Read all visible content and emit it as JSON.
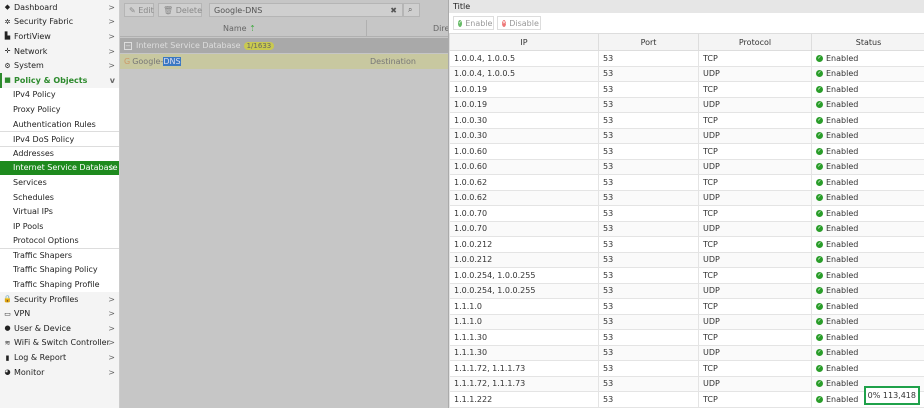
{
  "sidebar": {
    "items": [
      {
        "label": "Dashboard",
        "icon": "dashboard-icon",
        "glyph": "◆",
        "chev": ">"
      },
      {
        "label": "Security Fabric",
        "icon": "security-fabric-icon",
        "glyph": "✲",
        "chev": ">"
      },
      {
        "label": "FortiView",
        "icon": "fortiview-icon",
        "glyph": "▙",
        "chev": ">"
      },
      {
        "label": "Network",
        "icon": "network-icon",
        "glyph": "✛",
        "chev": ">"
      },
      {
        "label": "System",
        "icon": "gear-icon",
        "glyph": "⚙",
        "chev": ">"
      },
      {
        "label": "Policy & Objects",
        "icon": "policy-icon",
        "glyph": "■",
        "chev": "v"
      }
    ],
    "sub": [
      "IPv4 Policy",
      "Proxy Policy",
      "Authentication Rules",
      "IPv4 DoS Policy",
      "Addresses",
      "Internet Service Database",
      "Services",
      "Schedules",
      "Virtual IPs",
      "IP Pools",
      "Protocol Options",
      "Traffic Shapers",
      "Traffic Shaping Policy",
      "Traffic Shaping Profile"
    ],
    "bottom": [
      {
        "label": "Security Profiles",
        "icon": "lock-icon",
        "glyph": "🔒",
        "chev": ">"
      },
      {
        "label": "VPN",
        "icon": "vpn-icon",
        "glyph": "▭",
        "chev": ">"
      },
      {
        "label": "User & Device",
        "icon": "user-icon",
        "glyph": "●",
        "chev": ">"
      },
      {
        "label": "WiFi & Switch Controller",
        "icon": "wifi-icon",
        "glyph": "≋",
        "chev": ">"
      },
      {
        "label": "Log & Report",
        "icon": "log-icon",
        "glyph": "▮",
        "chev": ">"
      },
      {
        "label": "Monitor",
        "icon": "monitor-icon",
        "glyph": "◕",
        "chev": ">"
      }
    ]
  },
  "toolbar": {
    "edit": "Edit",
    "delete": "Delete",
    "search": "Google-DNS"
  },
  "list": {
    "col_name": "Name",
    "col_dir": "Dire",
    "group": "Internet Service Database",
    "badge": "1/1633",
    "entry_prefix": "Google-",
    "entry_highlight": "DNS",
    "direction": "Destination"
  },
  "panel": {
    "title": "Title",
    "enable": "Enable",
    "disable": "Disable",
    "headers": [
      "IP",
      "Port",
      "Protocol",
      "Status"
    ],
    "rows": [
      [
        "1.0.0.4, 1.0.0.5",
        "53",
        "TCP",
        "Enabled"
      ],
      [
        "1.0.0.4, 1.0.0.5",
        "53",
        "UDP",
        "Enabled"
      ],
      [
        "1.0.0.19",
        "53",
        "TCP",
        "Enabled"
      ],
      [
        "1.0.0.19",
        "53",
        "UDP",
        "Enabled"
      ],
      [
        "1.0.0.30",
        "53",
        "TCP",
        "Enabled"
      ],
      [
        "1.0.0.30",
        "53",
        "UDP",
        "Enabled"
      ],
      [
        "1.0.0.60",
        "53",
        "TCP",
        "Enabled"
      ],
      [
        "1.0.0.60",
        "53",
        "UDP",
        "Enabled"
      ],
      [
        "1.0.0.62",
        "53",
        "TCP",
        "Enabled"
      ],
      [
        "1.0.0.62",
        "53",
        "UDP",
        "Enabled"
      ],
      [
        "1.0.0.70",
        "53",
        "TCP",
        "Enabled"
      ],
      [
        "1.0.0.70",
        "53",
        "UDP",
        "Enabled"
      ],
      [
        "1.0.0.212",
        "53",
        "TCP",
        "Enabled"
      ],
      [
        "1.0.0.212",
        "53",
        "UDP",
        "Enabled"
      ],
      [
        "1.0.0.254, 1.0.0.255",
        "53",
        "TCP",
        "Enabled"
      ],
      [
        "1.0.0.254, 1.0.0.255",
        "53",
        "UDP",
        "Enabled"
      ],
      [
        "1.1.1.0",
        "53",
        "TCP",
        "Enabled"
      ],
      [
        "1.1.1.0",
        "53",
        "UDP",
        "Enabled"
      ],
      [
        "1.1.1.30",
        "53",
        "TCP",
        "Enabled"
      ],
      [
        "1.1.1.30",
        "53",
        "UDP",
        "Enabled"
      ],
      [
        "1.1.1.72, 1.1.1.73",
        "53",
        "TCP",
        "Enabled"
      ],
      [
        "1.1.1.72, 1.1.1.73",
        "53",
        "UDP",
        "Enabled"
      ],
      [
        "1.1.1.222",
        "53",
        "TCP",
        "Enabled"
      ]
    ],
    "counter": "0% 113,418"
  }
}
